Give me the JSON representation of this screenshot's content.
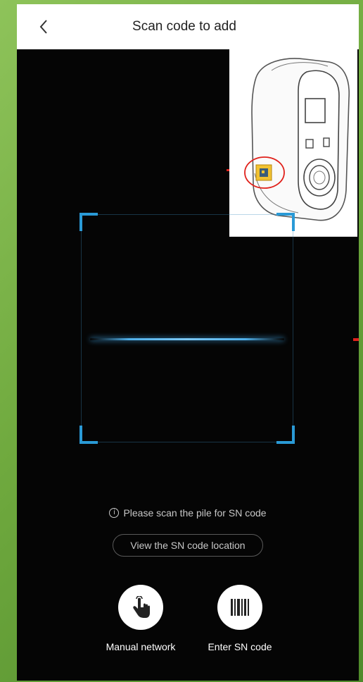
{
  "header": {
    "title": "Scan code to add",
    "back_icon": "chevron-left-icon"
  },
  "scanner": {
    "hint": "Please scan the pile for SN code",
    "hint_icon": "info-icon",
    "view_location_label": "View the SN code location",
    "accent_color": "#2a9ad6"
  },
  "actions": [
    {
      "label": "Manual network",
      "icon": "touch-hand-icon"
    },
    {
      "label": "Enter SN code",
      "icon": "barcode-icon"
    }
  ],
  "colors": {
    "header_bg": "#ffffff",
    "screen_bg": "#050505",
    "highlight": "#e0211b"
  }
}
